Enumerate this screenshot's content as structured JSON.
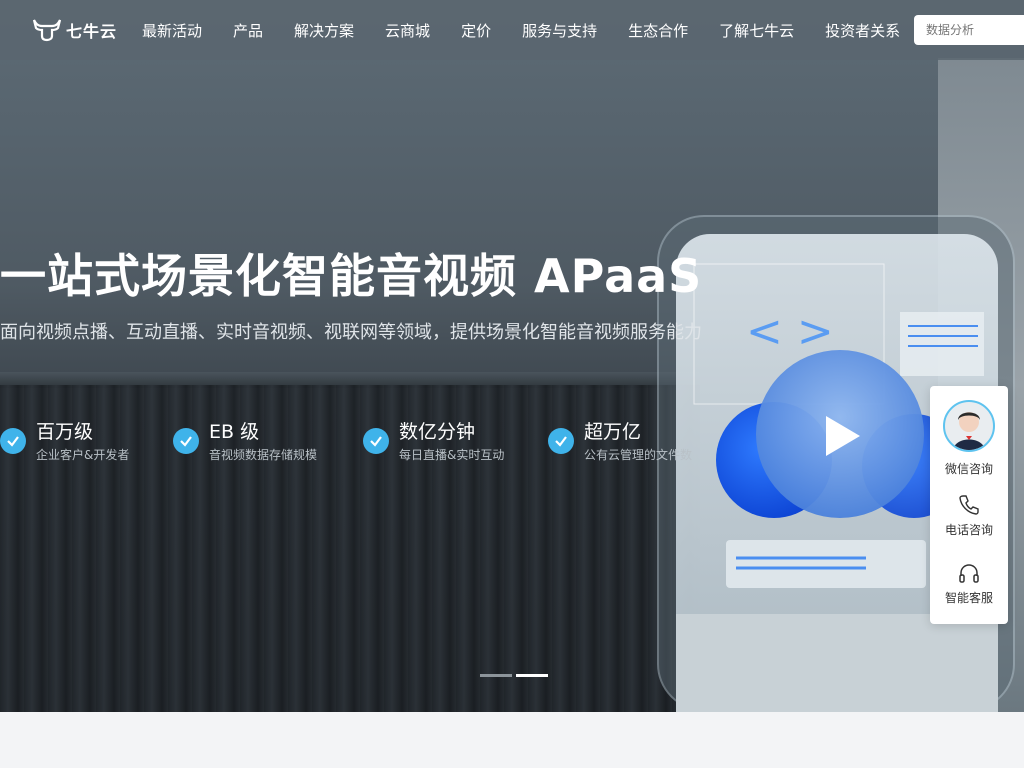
{
  "nav": {
    "logo_text": "七牛云",
    "items": [
      "最新活动",
      "产品",
      "解决方案",
      "云商城",
      "定价",
      "服务与支持",
      "生态合作",
      "了解七牛云",
      "投资者关系"
    ],
    "search_placeholder": "数据分析"
  },
  "hero": {
    "title": "一站式场景化智能音视频 APaaS",
    "subtitle": "面向视频点播、互动直播、实时音视频、视联网等领域，提供场景化智能音视频服务能力",
    "stats": [
      {
        "value": "百万级",
        "desc": "企业客户&开发者"
      },
      {
        "value": "EB 级",
        "desc": "音视频数据存储规模"
      },
      {
        "value": "数亿分钟",
        "desc": "每日直播&实时互动"
      },
      {
        "value": "超万亿",
        "desc": "公有云管理的文件数"
      }
    ],
    "slides_total": 2,
    "slide_active": 2
  },
  "side_panel": {
    "wechat": "微信咨询",
    "phone": "电话咨询",
    "service": "智能客服"
  },
  "colors": {
    "accent": "#3fb3ea",
    "nav_bg": "#5a6670"
  }
}
